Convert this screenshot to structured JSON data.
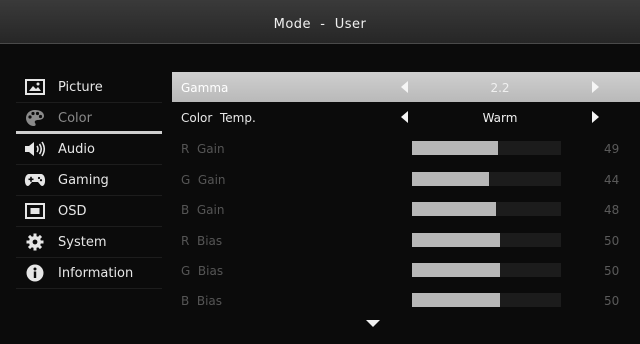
{
  "header": {
    "title": "Mode  -  User"
  },
  "sidebar": {
    "items": [
      {
        "label": "Picture",
        "icon": "picture-icon",
        "state": "normal"
      },
      {
        "label": "Color",
        "icon": "palette-icon",
        "state": "active"
      },
      {
        "label": "Audio",
        "icon": "speaker-icon",
        "state": "normal"
      },
      {
        "label": "Gaming",
        "icon": "gamepad-icon",
        "state": "normal"
      },
      {
        "label": "OSD",
        "icon": "osd-icon",
        "state": "normal"
      },
      {
        "label": "System",
        "icon": "gear-icon",
        "state": "normal"
      },
      {
        "label": "Information",
        "icon": "info-icon",
        "state": "normal"
      }
    ]
  },
  "settings": {
    "gamma": {
      "label": "Gamma",
      "value": "2.2"
    },
    "color_temp": {
      "label": "Color  Temp.",
      "value": "Warm"
    },
    "gains": [
      {
        "label": "R  Gain",
        "value": "49",
        "level": 49
      },
      {
        "label": "G  Gain",
        "value": "44",
        "level": 44
      },
      {
        "label": "B  Gain",
        "value": "48",
        "level": 48
      },
      {
        "label": "R  Bias",
        "value": "50",
        "level": 50
      },
      {
        "label": "G  Bias",
        "value": "50",
        "level": 50
      },
      {
        "label": "B  Bias",
        "value": "50",
        "level": 50
      }
    ]
  },
  "colors": {
    "selected_row": "#c4c4c4",
    "bar_fill": "#b7b7b7",
    "dim_text": "#555555",
    "background": "#0b0b0b"
  }
}
